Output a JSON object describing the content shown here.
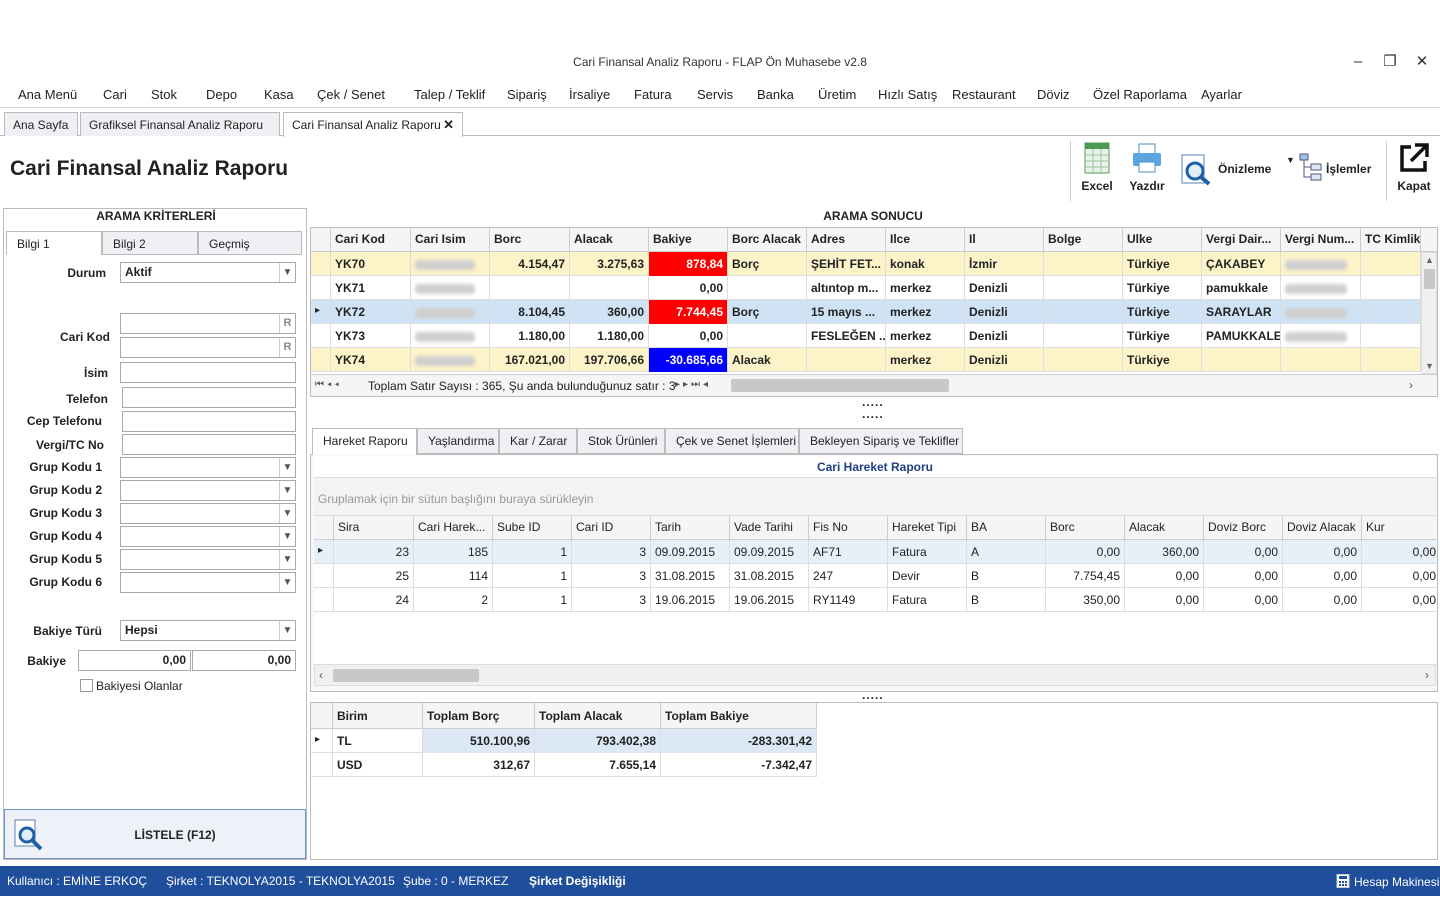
{
  "window": {
    "title": "Cari Finansal Analiz Raporu - FLAP Ön Muhasebe v2.8",
    "minimize": "–",
    "restore": "❐",
    "close": "✕"
  },
  "menu": [
    "Ana Menü",
    "Cari",
    "Stok",
    "Depo",
    "Kasa",
    "Çek / Senet",
    "Talep / Teklif",
    "Sipariş",
    "İrsaliye",
    "Fatura",
    "Servis",
    "Banka",
    "Üretim",
    "Hızlı Satış",
    "Restaurant",
    "Döviz",
    "Özel Raporlama",
    "Ayarlar"
  ],
  "doc_tabs": [
    "Ana Sayfa",
    "Grafiksel Finansal Analiz Raporu",
    "Cari Finansal Analiz Raporu"
  ],
  "doc_tab_close": "✕",
  "page_title": "Cari Finansal Analiz Raporu",
  "toolbar": {
    "excel": "Excel",
    "print": "Yazdır",
    "preview": "Önizleme",
    "actions": "İşlemler",
    "close": "Kapat"
  },
  "search_criteria": {
    "title": "ARAMA KRİTERLERİ",
    "tabs": [
      "Bilgi 1",
      "Bilgi 2",
      "Geçmiş"
    ],
    "durum_label": "Durum",
    "durum_value": "Aktif",
    "cari_kod_label": "Cari Kod",
    "r_btn": "R",
    "isim_label": "İsim",
    "telefon_label": "Telefon",
    "cep_label": "Cep Telefonu",
    "vergi_label": "Vergi/TC No",
    "grup_labels": [
      "Grup Kodu 1",
      "Grup Kodu 2",
      "Grup Kodu 3",
      "Grup Kodu 4",
      "Grup Kodu 5",
      "Grup Kodu 6"
    ],
    "bakiye_turu_label": "Bakiye Türü",
    "bakiye_turu_value": "Hepsi",
    "bakiye_label": "Bakiye",
    "bakiye_min": "0,00",
    "bakiye_max": "0,00",
    "bakiyesi_olanlar": "Bakiyesi Olanlar",
    "list_button": "LİSTELE (F12)"
  },
  "result": {
    "title": "ARAMA SONUCU",
    "columns": [
      "Cari Kod",
      "Cari Isim",
      "Borc",
      "Alacak",
      "Bakiye",
      "Borc Alacak",
      "Adres",
      "Ilce",
      "Il",
      "Bolge",
      "Ulke",
      "Vergi Dair...",
      "Vergi Num...",
      "TC Kimlik ..."
    ],
    "rows": [
      {
        "kod": "YK70",
        "borc": "4.154,47",
        "alacak": "3.275,63",
        "bakiye": "878,84",
        "ba": "Borç",
        "adres": "ŞEHİT FET...",
        "ilce": "konak",
        "il": "İzmir",
        "ulke": "Türkiye",
        "vergi_dairesi": "ÇAKABEY",
        "bg": "#fdf3c9",
        "bak_bg": "#ff0000"
      },
      {
        "kod": "YK71",
        "borc": "",
        "alacak": "",
        "bakiye": "0,00",
        "ba": "",
        "adres": "altıntop m...",
        "ilce": "merkez",
        "il": "Denizli",
        "ulke": "Türkiye",
        "vergi_dairesi": "pamukkale",
        "bg": "#ffffff",
        "bak_bg": ""
      },
      {
        "kod": "YK72",
        "borc": "8.104,45",
        "alacak": "360,00",
        "bakiye": "7.744,45",
        "ba": "Borç",
        "adres": "15 mayıs ...",
        "ilce": "merkez",
        "il": "Denizli",
        "ulke": "Türkiye",
        "vergi_dairesi": "SARAYLAR",
        "bg": "#cfe3f5",
        "bak_bg": "#ff0000"
      },
      {
        "kod": "YK73",
        "borc": "1.180,00",
        "alacak": "1.180,00",
        "bakiye": "0,00",
        "ba": "",
        "adres": "FESLEĞEN ...",
        "ilce": "merkez",
        "il": "Denizli",
        "ulke": "Türkiye",
        "vergi_dairesi": "PAMUKKALE",
        "bg": "#ffffff",
        "bak_bg": ""
      },
      {
        "kod": "YK74",
        "borc": "167.021,00",
        "alacak": "197.706,66",
        "bakiye": "-30.685,66",
        "ba": "Alacak",
        "adres": "",
        "ilce": "merkez",
        "il": "Denizli",
        "ulke": "Türkiye",
        "vergi_dairesi": "",
        "bg": "#fdf3c9",
        "bak_bg": "#0000ff"
      }
    ],
    "footer": "Toplam Satır Sayısı : 365, Şu anda bulunduğunuz satır : 3",
    "splitter": "....."
  },
  "bottom_tabs": [
    "Hareket Raporu",
    "Yaşlandırma",
    "Kar / Zarar",
    "Stok Ürünleri",
    "Çek ve Senet İşlemleri",
    "Bekleyen Sipariş ve Teklifler"
  ],
  "movement": {
    "title": "Cari Hareket Raporu",
    "group_hint": "Gruplamak için bir sütun başlığını buraya sürükleyin",
    "columns": [
      "Sira",
      "Cari Harek...",
      "Sube ID",
      "Cari ID",
      "Tarih",
      "Vade Tarihi",
      "Fis No",
      "Hareket Tipi",
      "BA",
      "Borc",
      "Alacak",
      "Doviz Borc",
      "Doviz Alacak",
      "Kur"
    ],
    "rows": [
      [
        "23",
        "185",
        "1",
        "3",
        "09.09.2015",
        "09.09.2015",
        "AF71",
        "Fatura",
        "A",
        "0,00",
        "360,00",
        "0,00",
        "0,00",
        "0,00"
      ],
      [
        "25",
        "114",
        "1",
        "3",
        "31.08.2015",
        "31.08.2015",
        "247",
        "Devir",
        "B",
        "7.754,45",
        "0,00",
        "0,00",
        "0,00",
        "0,00"
      ],
      [
        "24",
        "2",
        "1",
        "3",
        "19.06.2015",
        "19.06.2015",
        "RY1149",
        "Fatura",
        "B",
        "350,00",
        "0,00",
        "0,00",
        "0,00",
        "0,00"
      ]
    ]
  },
  "totals": {
    "columns": [
      "Birim",
      "Toplam Borç",
      "Toplam Alacak",
      "Toplam Bakiye"
    ],
    "rows": [
      [
        "TL",
        "510.100,96",
        "793.402,38",
        "-283.301,42"
      ],
      [
        "USD",
        "312,67",
        "7.655,14",
        "-7.342,47"
      ]
    ]
  },
  "status": {
    "user": "Kullanıcı : EMİNE ERKOÇ",
    "company": "Şirket : TEKNOLYA2015 - TEKNOLYA2015",
    "branch": "Şube : 0 - MERKEZ",
    "change_company": "Şirket Değişikliği",
    "calculator": "Hesap Makinesi"
  },
  "colors": {
    "accent": "#1f4e9c",
    "debt_red": "#ff0000",
    "credit_blue": "#0000ff",
    "row_yellow": "#fdf3c9",
    "row_selected": "#cfe3f5"
  }
}
